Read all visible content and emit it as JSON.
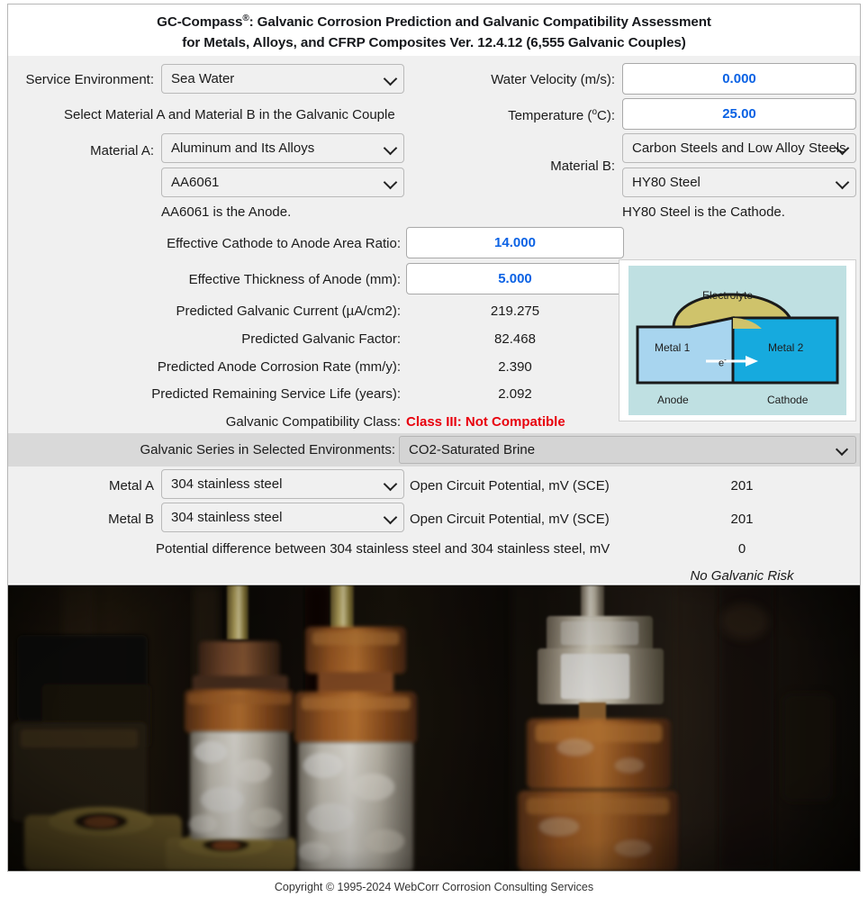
{
  "header": {
    "title_line1_a": "GC-Compass",
    "title_line1_sup": "®",
    "title_line1_b": ": Galvanic Corrosion Prediction and Galvanic Compatibility Assessment",
    "title_line2": "for Metals, Alloys, and CFRP Composites   Ver. 12.4.12 (6,555 Galvanic Couples)"
  },
  "inputs": {
    "service_environment_label": "Service Environment:",
    "service_environment_value": "Sea Water",
    "select_hint": "Select Material A and Material B in the Galvanic Couple",
    "material_a_label": "Material A:",
    "material_a_family": "Aluminum and Its Alloys",
    "material_a_alloy": "AA6061",
    "anode_note": "AA6061 is the Anode.",
    "water_velocity_label": "Water Velocity (m/s):",
    "water_velocity_value": "0.000",
    "temperature_label": "Temperature (º C):",
    "temperature_label_pre": "Temperature (",
    "temperature_label_sup": "o",
    "temperature_label_post": "C):",
    "temperature_value": "25.00",
    "material_b_label": "Material B:",
    "material_b_family": "Carbon Steels and Low Alloy Steels",
    "material_b_alloy": "HY80 Steel",
    "cathode_note": "HY80 Steel is the Cathode."
  },
  "results": {
    "area_ratio_label": "Effective Cathode to Anode Area Ratio:",
    "area_ratio_value": "14.000",
    "thickness_label": "Effective Thickness of Anode (mm):",
    "thickness_value": "5.000",
    "rows": [
      {
        "label": "Predicted Galvanic Current (µA/cm2):",
        "value": "219.275"
      },
      {
        "label": "Predicted Galvanic Factor:",
        "value": "82.468"
      },
      {
        "label": "Predicted Anode Corrosion Rate (mm/y):",
        "value": "2.390"
      },
      {
        "label": "Predicted Remaining Service Life (years):",
        "value": "2.092"
      }
    ],
    "class_label": "Galvanic Compatibility Class:",
    "class_value": "Class III: Not Compatible",
    "class_color": "#e8000d"
  },
  "diagram": {
    "electrolyte": "Electrolyte",
    "metal1": "Metal 1",
    "metal2": "Metal 2",
    "electron": "e",
    "electron_sup": "-",
    "anode": "Anode",
    "cathode": "Cathode",
    "bg_color": "#bfe0e2",
    "electrolyte_color": "#cfc36b",
    "metal1_color": "#a8d5ef",
    "metal2_color": "#16aade"
  },
  "galvanic_series": {
    "band_label": "Galvanic Series in Selected Environments:",
    "band_value": "CO2-Saturated Brine",
    "metal_a_label": "Metal A",
    "metal_a_value": "304 stainless steel",
    "metal_a_ocp_label": "Open Circuit Potential, mV (SCE)",
    "metal_a_ocp_value": "201",
    "metal_b_label": "Metal B",
    "metal_b_value": "304 stainless steel",
    "metal_b_ocp_label": "Open Circuit Potential, mV (SCE)",
    "metal_b_ocp_value": "201",
    "difference_label": "Potential difference between 304 stainless steel and 304 stainless steel, mV",
    "difference_value": "0",
    "risk_text": "No Galvanic Risk"
  },
  "footer": {
    "copyright": "Copyright © 1995-2024 WebCorr Corrosion Consulting Services"
  }
}
